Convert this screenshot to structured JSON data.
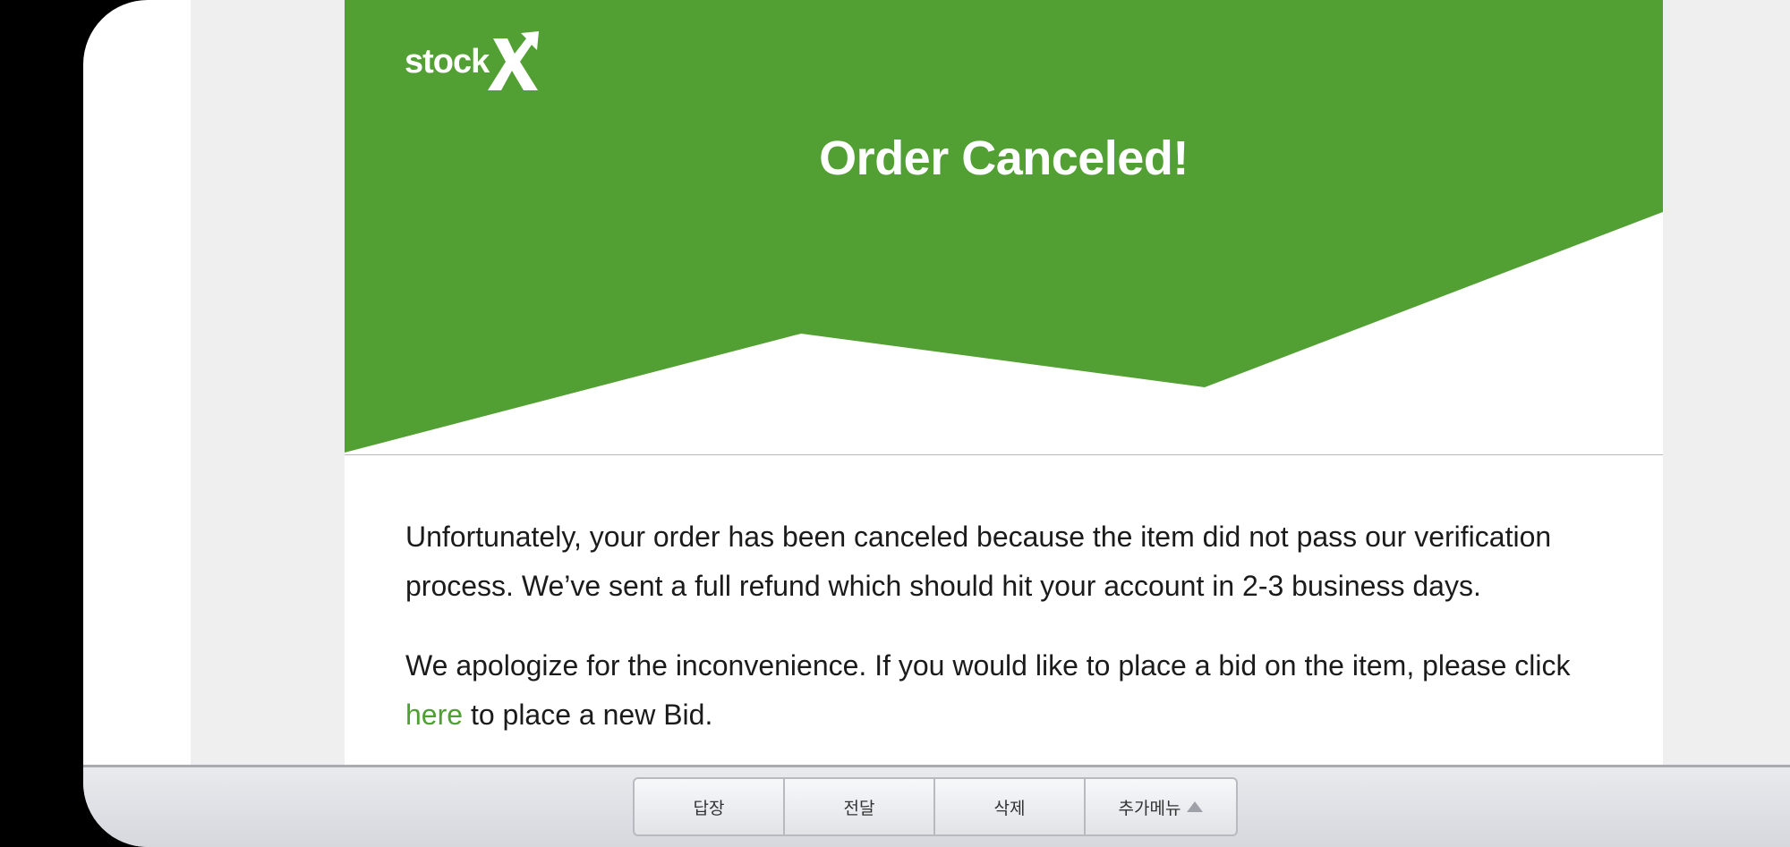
{
  "email": {
    "logo_text": "stock",
    "headline": "Order Canceled!",
    "paragraph1": "Unfortunately, your order has been canceled because the item did not pass our verification process. We’ve sent a full refund which should hit your account in 2-3 business days.",
    "paragraph2_before": "We apologize for the inconvenience. If you would like to place a bid on the item, please click ",
    "paragraph2_link": "here",
    "paragraph2_after": " to place a new Bid."
  },
  "toolbar": {
    "reply": "답장",
    "forward": "전달",
    "delete": "삭제",
    "more": "추가메뉴"
  },
  "colors": {
    "brand_green": "#529f33",
    "link_green": "#4f9f34",
    "viewer_background": "#efefef"
  },
  "icons": {
    "logo_mark": "stockx-x-arrow-icon",
    "more_menu": "triangle-up-icon"
  }
}
